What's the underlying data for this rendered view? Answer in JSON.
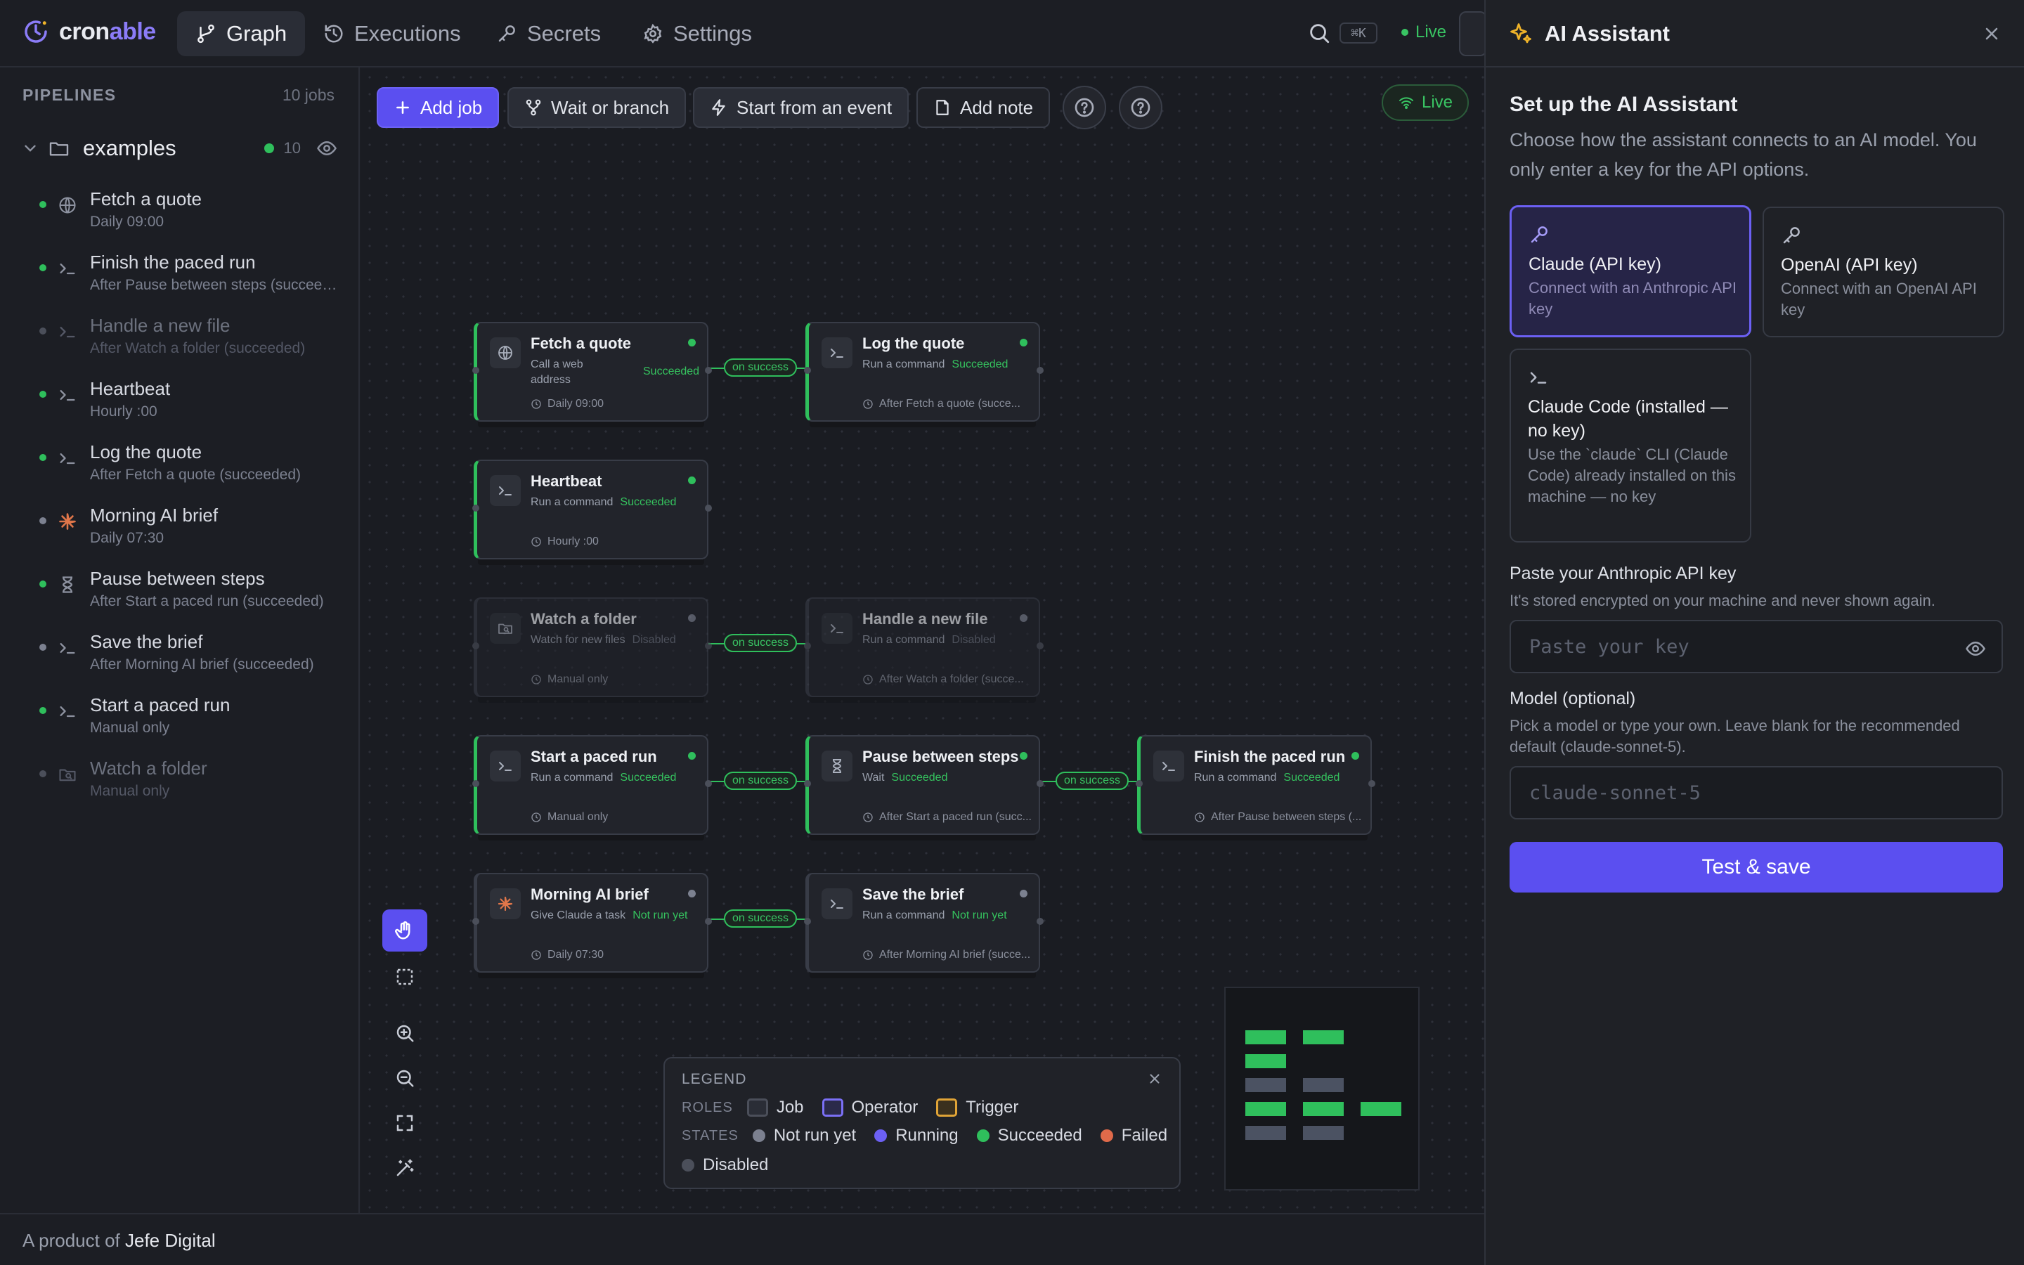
{
  "app": {
    "name_a": "cron",
    "name_b": "able"
  },
  "nav": {
    "tabs": [
      {
        "label": "Graph",
        "icon": "branch-icon",
        "active": true
      },
      {
        "label": "Executions",
        "icon": "history-icon"
      },
      {
        "label": "Secrets",
        "icon": "key-icon"
      },
      {
        "label": "Settings",
        "icon": "gear-icon"
      }
    ],
    "shortcut": "⌘K",
    "status": "Live"
  },
  "sidebar": {
    "heading": "PIPELINES",
    "count": "10 jobs",
    "folder": {
      "name": "examples",
      "count": "10"
    },
    "items": [
      {
        "title": "Fetch a quote",
        "sub": "Daily 09:00",
        "icon": "globe-icon",
        "status": "green"
      },
      {
        "title": "Finish the paced run",
        "sub": "After Pause between steps (succeeded)",
        "icon": "terminal-icon",
        "status": "green"
      },
      {
        "title": "Handle a new file",
        "sub": "After Watch a folder (succeeded)",
        "icon": "terminal-icon",
        "status": "grey",
        "dim": true
      },
      {
        "title": "Heartbeat",
        "sub": "Hourly :00",
        "icon": "terminal-icon",
        "status": "green"
      },
      {
        "title": "Log the quote",
        "sub": "After Fetch a quote (succeeded)",
        "icon": "terminal-icon",
        "status": "green"
      },
      {
        "title": "Morning AI brief",
        "sub": "Daily 07:30",
        "icon": "claude-icon",
        "status": "grey"
      },
      {
        "title": "Pause between steps",
        "sub": "After Start a paced run (succeeded)",
        "icon": "hourglass-icon",
        "status": "green"
      },
      {
        "title": "Save the brief",
        "sub": "After Morning AI brief (succeeded)",
        "icon": "terminal-icon",
        "status": "grey"
      },
      {
        "title": "Start a paced run",
        "sub": "Manual only",
        "icon": "terminal-icon",
        "status": "green"
      },
      {
        "title": "Watch a folder",
        "sub": "Manual only",
        "icon": "folder-watch-icon",
        "status": "grey",
        "dim": true
      }
    ]
  },
  "toolbar": {
    "add_job": "Add job",
    "wait_branch": "Wait or branch",
    "start_event": "Start from an event",
    "add_note": "Add note",
    "live": "Live"
  },
  "graph": {
    "edge_label": "on success",
    "nodes": [
      {
        "title": "Fetch a quote",
        "sub1": "Call a web",
        "sub2": "address",
        "state": "Succeeded",
        "schedule": "Daily 09:00",
        "icon": "globe-icon"
      },
      {
        "title": "Log the quote",
        "sub1": "Run a command",
        "state": "Succeeded",
        "schedule": "After Fetch a quote (succe...",
        "icon": "terminal-icon"
      },
      {
        "title": "Heartbeat",
        "sub1": "Run a command",
        "state": "Succeeded",
        "schedule": "Hourly :00",
        "icon": "terminal-icon"
      },
      {
        "title": "Watch a folder",
        "sub1": "Watch for new files",
        "state": "Disabled",
        "schedule": "Manual only",
        "icon": "folder-watch-icon"
      },
      {
        "title": "Handle a new file",
        "sub1": "Run a command",
        "state": "Disabled",
        "schedule": "After Watch a folder (succe...",
        "icon": "terminal-icon"
      },
      {
        "title": "Start a paced run",
        "sub1": "Run a command",
        "state": "Succeeded",
        "schedule": "Manual only",
        "icon": "terminal-icon"
      },
      {
        "title": "Pause between steps",
        "sub1": "Wait",
        "state": "Succeeded",
        "schedule": "After Start a paced run (succ...",
        "icon": "hourglass-icon"
      },
      {
        "title": "Finish the paced run",
        "sub1": "Run a command",
        "state": "Succeeded",
        "schedule": "After Pause between steps (...",
        "icon": "terminal-icon"
      },
      {
        "title": "Morning AI brief",
        "sub1": "Give Claude a task",
        "state": "Not run yet",
        "schedule": "Daily 07:30",
        "icon": "claude-icon"
      },
      {
        "title": "Save the brief",
        "sub1": "Run a command",
        "state": "Not run yet",
        "schedule": "After Morning AI brief (succe...",
        "icon": "terminal-icon"
      }
    ]
  },
  "legend": {
    "title": "LEGEND",
    "roles_label": "ROLES",
    "states_label": "STATES",
    "roles": [
      "Job",
      "Operator",
      "Trigger"
    ],
    "states": [
      "Not run yet",
      "Running",
      "Succeeded",
      "Failed",
      "Disabled"
    ]
  },
  "colors": {
    "accent": "#5b4ff0",
    "success": "#2fbf5c",
    "failed": "#e06a4a",
    "running": "#6c60f4",
    "idle": "#7c8190"
  },
  "footer": {
    "prefix": "A product of",
    "brand": "Jefe Digital"
  },
  "panel": {
    "title": "AI Assistant",
    "heading": "Set up the AI Assistant",
    "description": "Choose how the assistant connects to an AI model. You only enter a key for the API options.",
    "options": [
      {
        "title": "Claude (API key)",
        "desc": "Connect with an Anthropic API key",
        "selected": true,
        "icon": "key-icon"
      },
      {
        "title": "OpenAI (API key)",
        "desc": "Connect with an OpenAI API key",
        "selected": false,
        "icon": "key-icon"
      },
      {
        "title": "Claude Code (installed — no key)",
        "desc": "Use the `claude` CLI (Claude Code) already installed on this machine — no key",
        "selected": false,
        "icon": "terminal-icon"
      }
    ],
    "key_label": "Paste your Anthropic API key",
    "key_help": "It's stored encrypted on your machine and never shown again.",
    "key_placeholder": "Paste your key",
    "model_label": "Model (optional)",
    "model_help": "Pick a model or type your own. Leave blank for the recommended default (claude-sonnet-5).",
    "model_placeholder": "claude-sonnet-5",
    "submit": "Test & save"
  }
}
